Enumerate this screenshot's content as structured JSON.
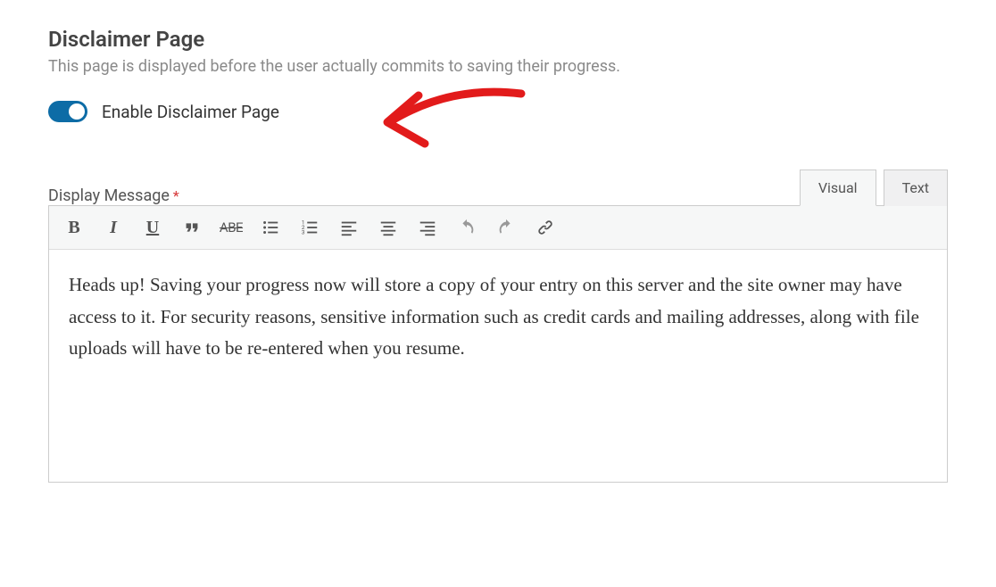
{
  "section": {
    "title": "Disclaimer Page",
    "description": "This page is displayed before the user actually commits to saving their progress."
  },
  "toggle": {
    "label": "Enable Disclaimer Page",
    "enabled": true
  },
  "field": {
    "label": "Display Message",
    "required_marker": "*"
  },
  "editor": {
    "tabs": {
      "visual": "Visual",
      "text": "Text",
      "active": "visual"
    },
    "toolbar": {
      "bold": "B",
      "italic": "I",
      "underline": "U",
      "quote": "quote",
      "strike": "ABE",
      "ul": "bulleted-list",
      "ol": "numbered-list",
      "align_left": "align-left",
      "align_center": "align-center",
      "align_right": "align-right",
      "undo": "undo",
      "redo": "redo",
      "link": "link"
    },
    "content": "Heads up! Saving your progress now will store a copy of your entry on this server and the site owner may have access to it. For security reasons, sensitive information such as credit cards and mailing addresses, along with file uploads will have to be re-entered when you resume."
  },
  "annotation": {
    "arrow_color": "#e21b1b"
  }
}
